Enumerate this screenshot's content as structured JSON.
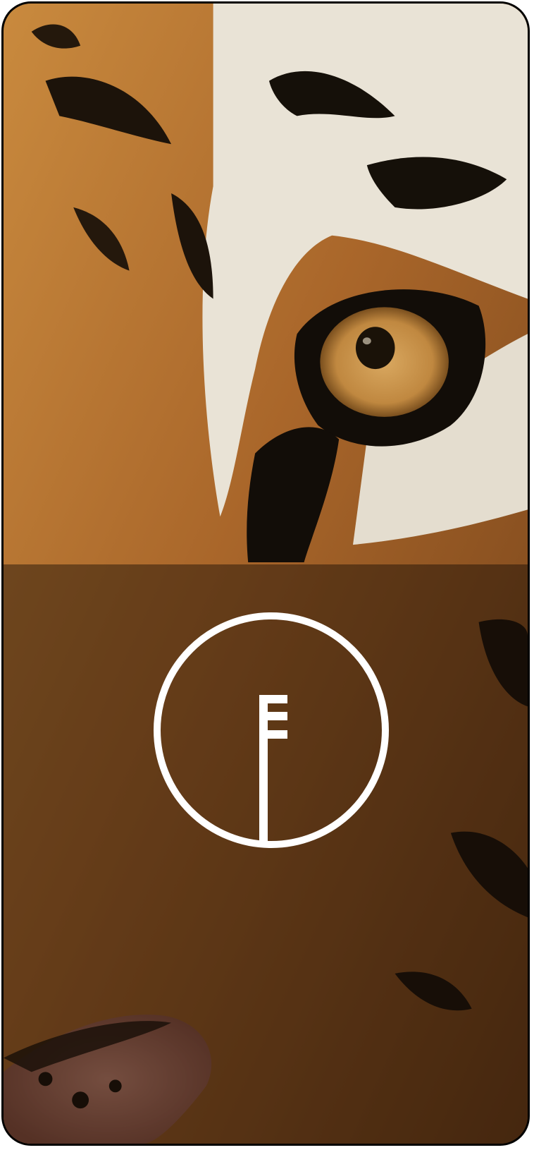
{
  "scene": {
    "subject": "tiger-face-closeup",
    "palette": {
      "fur_orange": "#b8732c",
      "fur_dark_orange": "#8a4f1c",
      "fur_white": "#e8e2d6",
      "stripe_black": "#14100c",
      "eye_iris": "#c9964e",
      "nose_pink": "#a86a52",
      "overlay_tint": "#2a180b"
    }
  },
  "logo": {
    "icon": "circle-key-logo-icon",
    "color": "#ffffff"
  }
}
